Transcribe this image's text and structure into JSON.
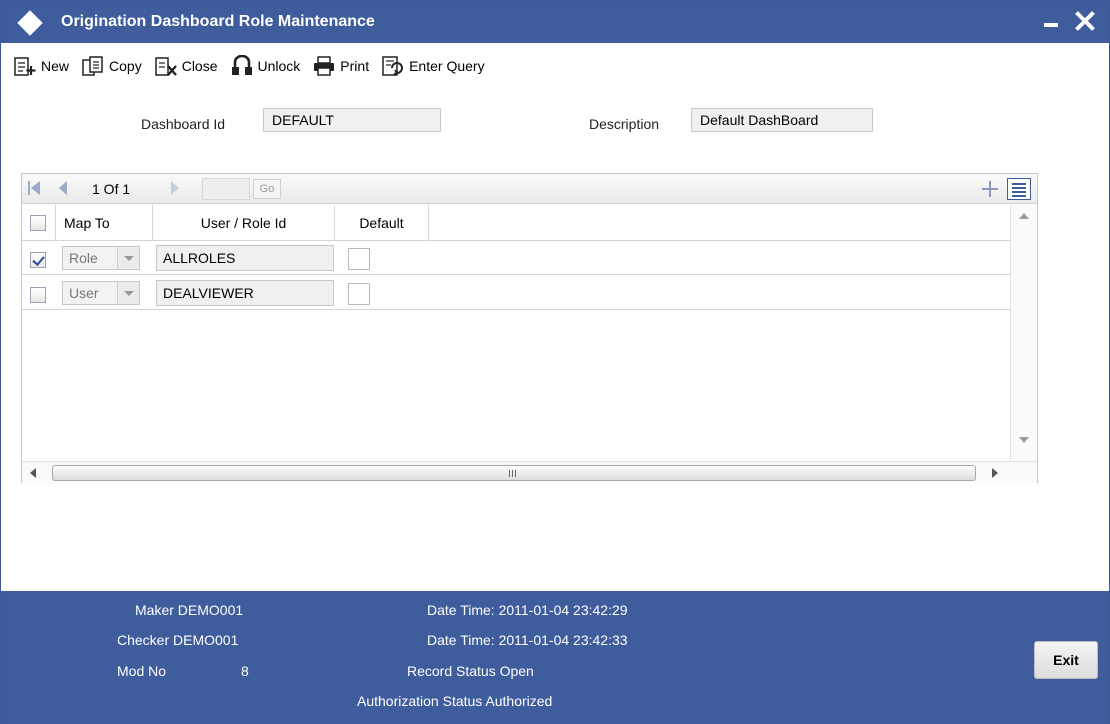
{
  "window": {
    "title": "Origination Dashboard Role Maintenance"
  },
  "toolbar": {
    "new_label": "New",
    "copy_label": "Copy",
    "close_label": "Close",
    "unlock_label": "Unlock",
    "print_label": "Print",
    "enter_query_label": "Enter Query"
  },
  "form": {
    "dashboard_id_label": "Dashboard Id",
    "dashboard_id_value": "DEFAULT",
    "description_label": "Description",
    "description_value": "Default DashBoard"
  },
  "grid": {
    "pagination": {
      "text": "1 Of 1",
      "go_label": "Go"
    },
    "columns": {
      "map_to": "Map To",
      "user_role_id": "User / Role Id",
      "default": "Default"
    },
    "rows": [
      {
        "checked": true,
        "map_to": "Role",
        "user_role_id": "ALLROLES",
        "default": false
      },
      {
        "checked": false,
        "map_to": "User",
        "user_role_id": "DEALVIEWER",
        "default": false
      }
    ],
    "scroll_grip": "III"
  },
  "footer": {
    "maker": "Maker DEMO001",
    "maker_datetime": "Date Time: 2011-01-04 23:42:29",
    "checker": "Checker DEMO001",
    "checker_datetime": "Date Time: 2011-01-04 23:42:33",
    "mod_no_label": "Mod No",
    "mod_no_value": "8",
    "record_status": "Record Status Open",
    "authorization_status": "Authorization Status Authorized",
    "exit_label": "Exit"
  },
  "colors": {
    "brand": "#3f5c9c",
    "field_bg": "#f0f0f0"
  }
}
